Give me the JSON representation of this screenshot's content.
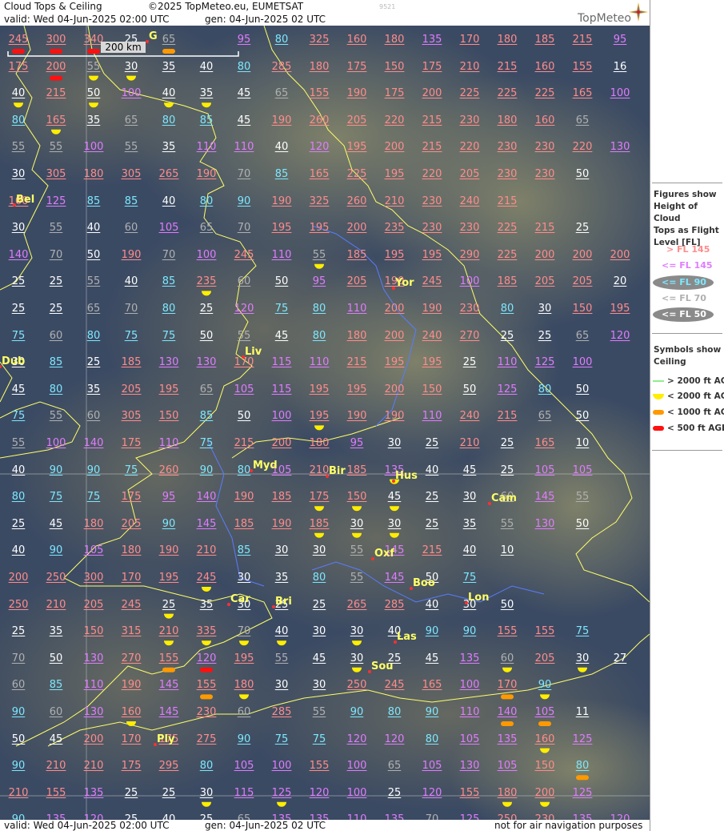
{
  "header": {
    "title": "Cloud Tops & Ceiling",
    "copyright": "©2025 TopMeteo.eu, EUMETSAT",
    "valid": "valid:  Wed  04-Jun-2025  02:00 UTC",
    "gen": "gen: 04-Jun-2025 02 UTC",
    "code": "9521",
    "brand": "TopMeteo"
  },
  "footer": {
    "valid": "valid:  Wed  04-Jun-2025  02:00 UTC",
    "gen": "gen: 04-Jun-2025 02 UTC",
    "disclaimer": "not for air navigation purposes"
  },
  "scale_bar": {
    "label": "200 km"
  },
  "legend": {
    "heading": [
      "Figures show",
      "Height of Cloud",
      "Tops as Flight",
      "Level  [FL]"
    ],
    "items": [
      {
        "text": "> FL 145",
        "color": "#ff8c8c"
      },
      {
        "text": "<= FL 145",
        "color": "#e07cff"
      },
      {
        "text": "<= FL 90",
        "color": "#7ce8ff"
      },
      {
        "text": "<= FL 70",
        "color": "#b0b0b0"
      },
      {
        "text": "<= FL 50",
        "color": "#ffffff"
      }
    ],
    "symbols_heading": [
      "Symbols show",
      "Ceiling"
    ],
    "symbols": [
      {
        "text": "> 2000 ft AGL",
        "color": "#90ee90"
      },
      {
        "text": "< 2000 ft AGL",
        "color": "#ffee00"
      },
      {
        "text": "< 1000 ft AGL",
        "color": "#ff9900"
      },
      {
        "text": "< 500 ft AGL",
        "color": "#ff1010"
      }
    ]
  },
  "cities": [
    {
      "name": "Bel"
    },
    {
      "name": "Yor"
    },
    {
      "name": "Liv"
    },
    {
      "name": "Myd"
    },
    {
      "name": "Bir"
    },
    {
      "name": "Hus"
    },
    {
      "name": "Cam"
    },
    {
      "name": "Oxf"
    },
    {
      "name": "Boo"
    },
    {
      "name": "Lon"
    },
    {
      "name": "Car"
    },
    {
      "name": "Bri"
    },
    {
      "name": "Las"
    },
    {
      "name": "Sou"
    },
    {
      "name": "Ply"
    },
    {
      "name": "Dub"
    },
    {
      "name": "G"
    }
  ],
  "rows": [
    "245r 300r 340r 25 65o 0 95 80 325 160 180 135 170 180 185 215 95",
    "175 200r 55y 30y 35 40 80 285 180 175 150 175 210 215 160 155 16",
    "40y 215 50y 100 40y 35y 45 65 155 190 175 200 225 225 225 165 100",
    "80 165y 35 65 80 85 45 190 260 205 220 215 230 180 160 65",
    "55 55 100 55 35 110 110 40 120 195 200 215 220 230 230 220 130",
    "30 305 180 305 265 190 70 85 165 225 195 220 205 230 230 50",
    "160 125 85 85 40 80 90 190 325 260 210 230 240 215",
    "30 55 40 60 105 65 70 195 195 200 235 230 230 225 215 25",
    "140 70 50 190 70 100 245 110 55y 185 195 195 290 225 200 200 200",
    "25 25 55 40 85 235y 60 50 95 205 190 245 100 185 205 205 20",
    "25 25 65 70 80 25 120 75 80 110 200 190 230 80 30 150 195",
    "75 60 80 75 75 50 55 45 80 180 200 240 270 25 25 65 120 12",
    "30 85 25 185 130 130 170 115 110 215 195 195 25 110 125 100",
    "45 80 35 205 195 65 105 115 195 195 200 150 50 125 80 50",
    "75 55 60 305 150 85 50 100 195y 190 190 110 240 215 65 50",
    "55 100 140 175 110 75 215 200 180 95 30 25 210 25 165 10",
    "40 90 90 75 260 90 80 105 210 185 135y 40 45 25 105 105",
    "80 75 75 175 95 140 190 185 175y 150y 45y 25 30 60 145 55",
    "25 45 180 205 90 145 185 190 185y 30y 30y 25 35 55 130 50",
    "40 90 105 180 190 210 85 30 30 55 145 215 40 10",
    "200 250 300 170 195 245y 30 35 80 55 145 50 75",
    "250 210 205 245 25y 35 30 25 25 265 285 40 30 50",
    "25 35 150 315 210y 335y 70y 40y 30 30y 40 90 90 155 155 75",
    "70 50 130 270 155o 120r 195 55 45 30y 25 45 135 60y 205 30y 27",
    "60 85 110 190 145 155o 180y 30 30 250 245 165 100 170o 90y",
    "90 60 130 160y 145 230 60 285 55 90 80 90 110 140o 105o 11",
    "50 45 200 170 175 275 90 75 75 120 120 80 105 135 160y 125",
    "90 210 210 175 295 80 105 100 155 100 65 105 130 105 150 80o",
    "210 155 135 25 25 30y 115 125y 120 100 25 120 155 180y 200y 125",
    "90 135 120 25 40 25 65 135 135 110 135 70 125 250 230 135 120"
  ]
}
